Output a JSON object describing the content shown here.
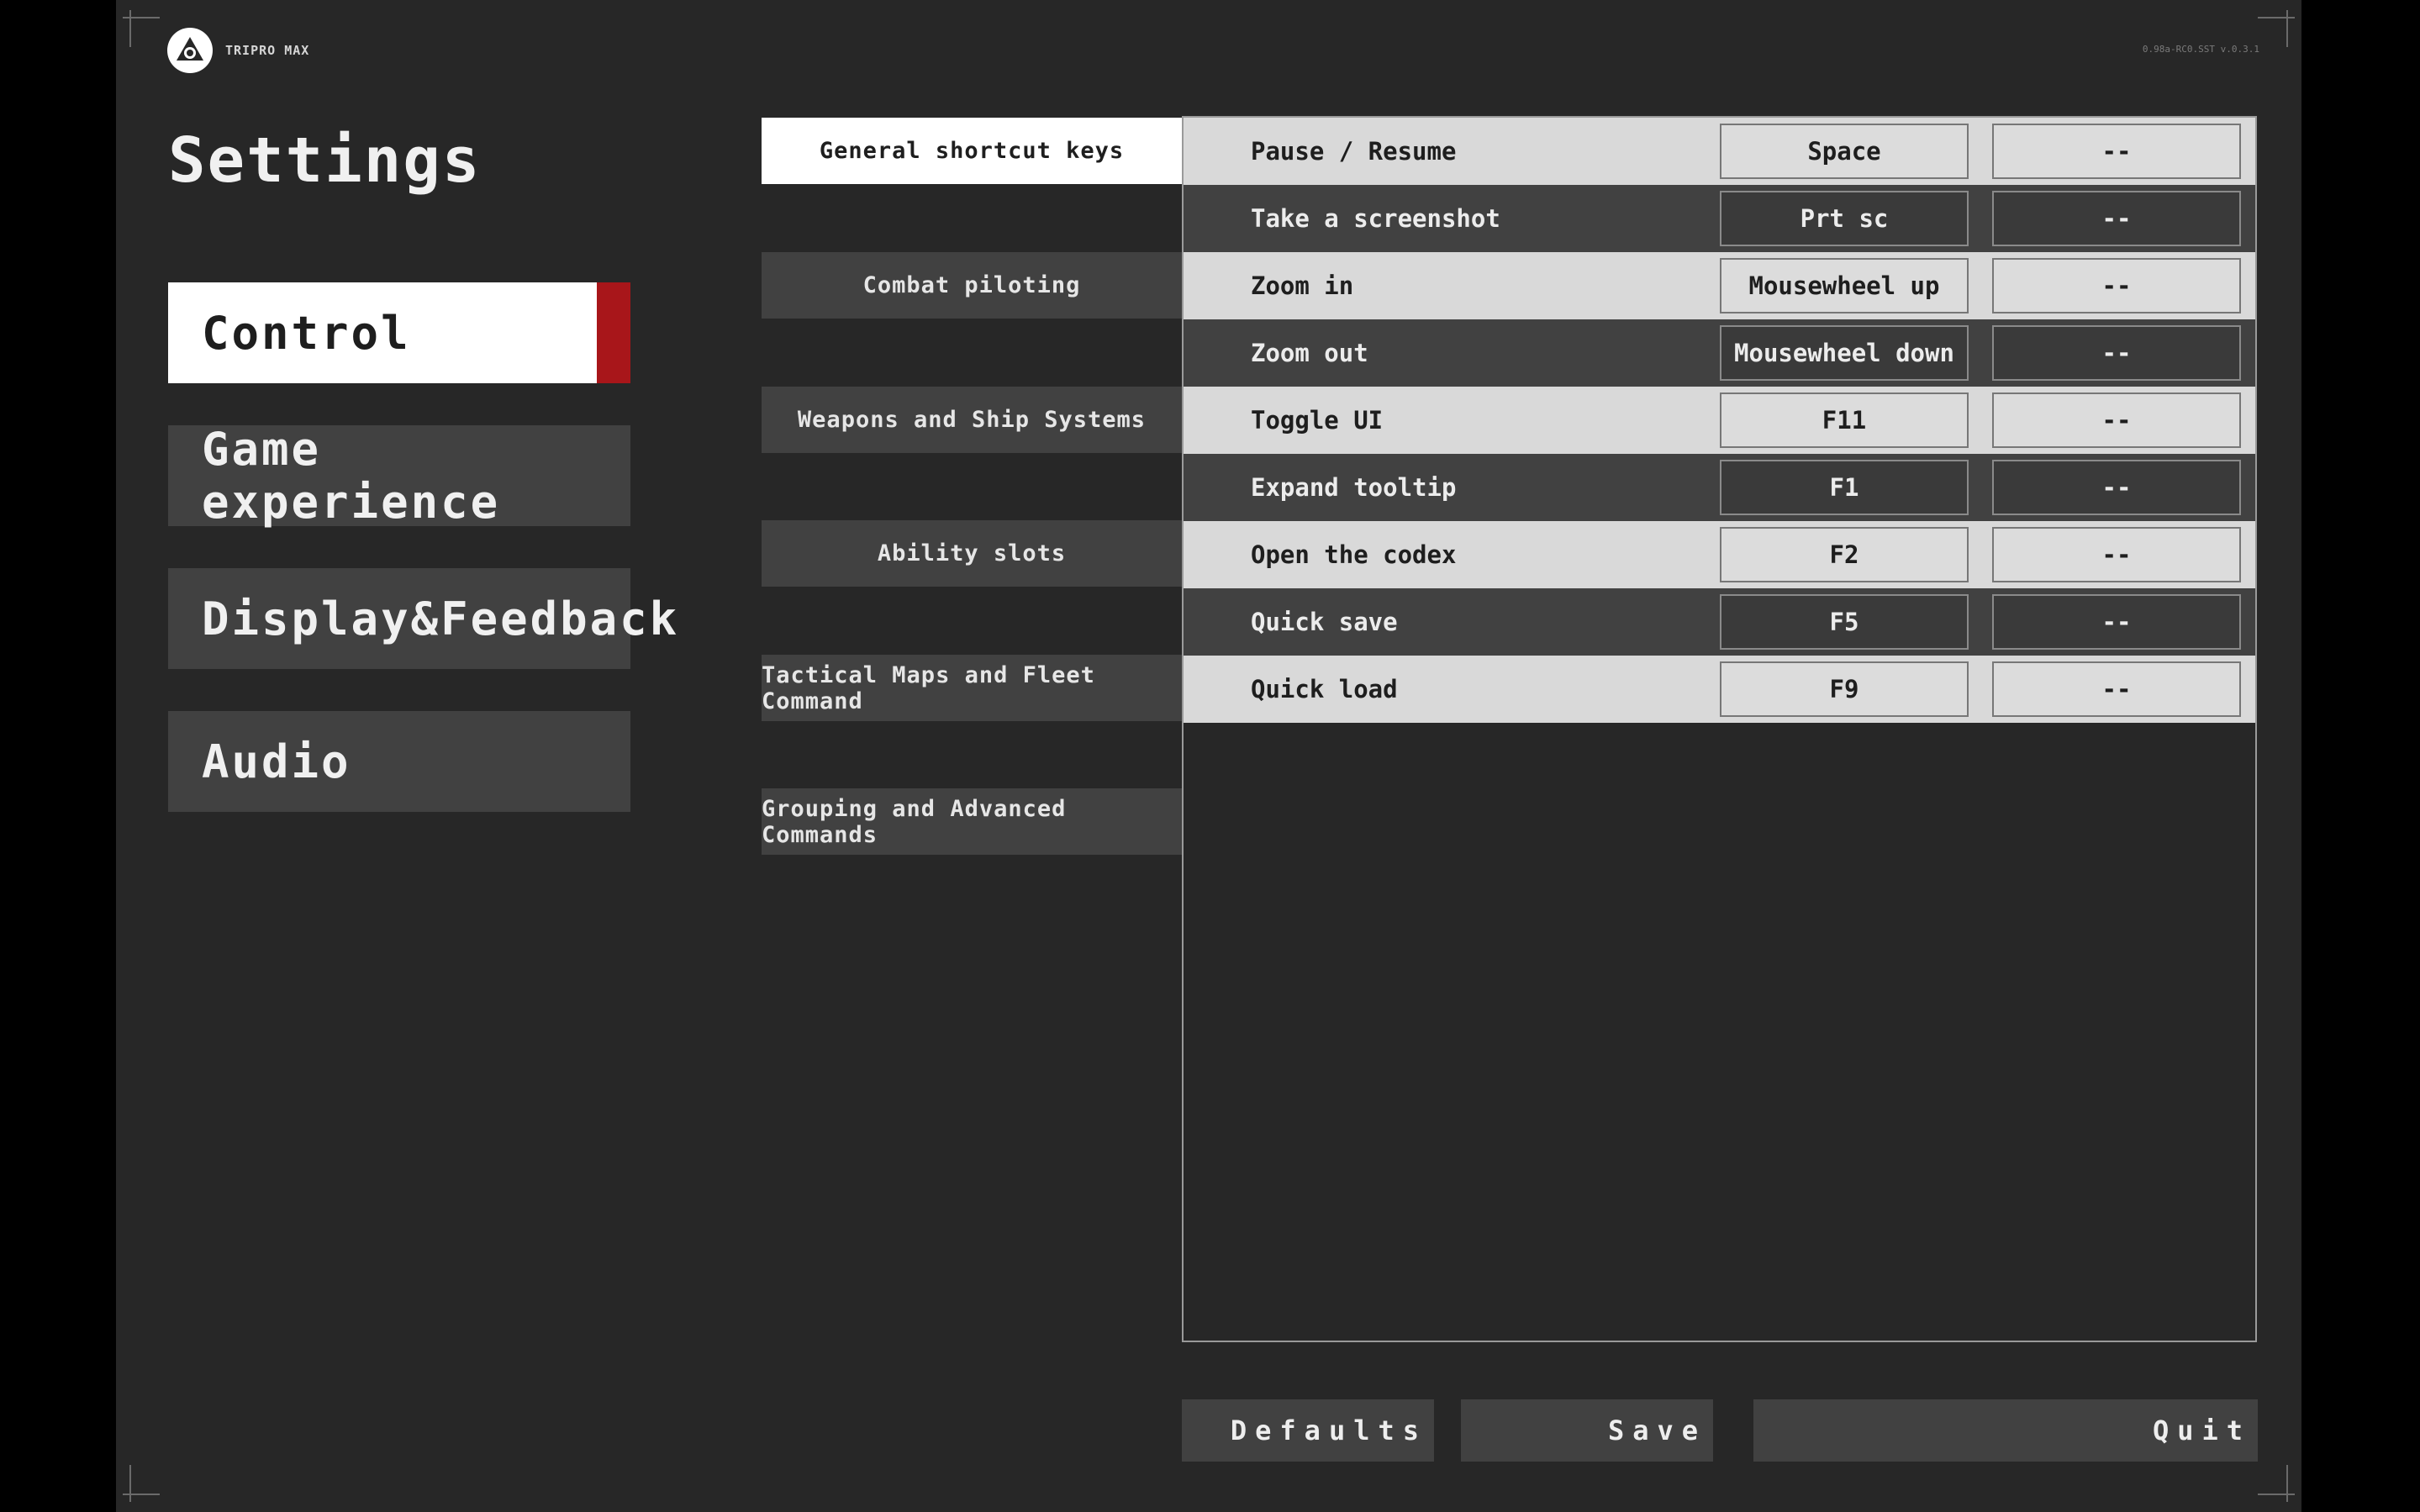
{
  "header": {
    "brand": "TRIPRO MAX",
    "version": "0.98a-RC0.SST v.0.3.1",
    "title": "Settings"
  },
  "categories": [
    {
      "label": "Control",
      "active": true
    },
    {
      "label": "Game experience",
      "active": false
    },
    {
      "label": "Display&Feedback",
      "active": false
    },
    {
      "label": "Audio",
      "active": false
    }
  ],
  "subcategories": [
    {
      "label": "General shortcut keys",
      "active": true
    },
    {
      "label": "Combat piloting",
      "active": false
    },
    {
      "label": "Weapons and Ship Systems",
      "active": false
    },
    {
      "label": "Ability slots",
      "active": false
    },
    {
      "label": "Tactical Maps and Fleet Command",
      "active": false
    },
    {
      "label": "Grouping and Advanced Commands",
      "active": false
    }
  ],
  "bindings": [
    {
      "action": "Pause / Resume",
      "primary": "Space",
      "secondary": "--"
    },
    {
      "action": "Take a screenshot",
      "primary": "Prt sc",
      "secondary": "--"
    },
    {
      "action": "Zoom in",
      "primary": "Mousewheel up",
      "secondary": "--"
    },
    {
      "action": "Zoom out",
      "primary": "Mousewheel down",
      "secondary": "--"
    },
    {
      "action": "Toggle UI",
      "primary": "F11",
      "secondary": "--"
    },
    {
      "action": "Expand tooltip",
      "primary": "F1",
      "secondary": "--"
    },
    {
      "action": "Open the codex",
      "primary": "F2",
      "secondary": "--"
    },
    {
      "action": "Quick save",
      "primary": "F5",
      "secondary": "--"
    },
    {
      "action": "Quick load",
      "primary": "F9",
      "secondary": "--"
    }
  ],
  "footer": {
    "defaults_label": "Defaults",
    "save_label": "Save",
    "quit_label": "Quit"
  },
  "colors": {
    "accent": "#a8161a",
    "panel": "#414141",
    "background": "#272727",
    "active": "#ffffff"
  }
}
